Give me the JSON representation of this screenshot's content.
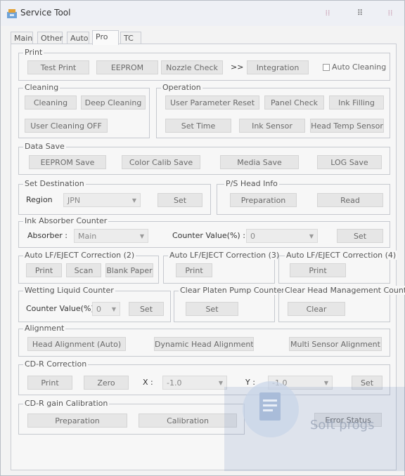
{
  "window": {
    "title": "Service Tool"
  },
  "tabs": [
    "Main",
    "Other",
    "Auto",
    "Pro",
    "TC"
  ],
  "print": {
    "label": "Print",
    "test_print": "Test Print",
    "eeprom": "EEPROM",
    "nozzle_check": "Nozzle Check",
    "arrows": ">>",
    "integration": "Integration",
    "auto_cleaning": "Auto Cleaning"
  },
  "cleaning": {
    "label": "Cleaning",
    "cleaning": "Cleaning",
    "deep_cleaning": "Deep Cleaning",
    "user_cleaning_off": "User Cleaning OFF"
  },
  "operation": {
    "label": "Operation",
    "user_param_reset": "User Parameter Reset",
    "panel_check": "Panel Check",
    "ink_filling": "Ink Filling",
    "set_time": "Set Time",
    "ink_sensor": "Ink Sensor",
    "head_temp_sensor": "Head Temp Sensor"
  },
  "data_save": {
    "label": "Data Save",
    "eeprom_save": "EEPROM Save",
    "color_calib_save": "Color Calib Save",
    "media_save": "Media Save",
    "log_save": "LOG Save"
  },
  "set_destination": {
    "label": "Set Destination",
    "region_label": "Region",
    "region_value": "JPN",
    "set": "Set"
  },
  "ps_head_info": {
    "label": "P/S Head Info",
    "preparation": "Preparation",
    "read": "Read"
  },
  "ink_absorber": {
    "label": "Ink Absorber Counter",
    "absorber_label": "Absorber :",
    "absorber_value": "Main",
    "counter_label": "Counter Value(%) :",
    "counter_value": "0",
    "set": "Set"
  },
  "auto_lf_2": {
    "label": "Auto LF/EJECT Correction (2)",
    "print": "Print",
    "scan": "Scan",
    "blank_paper": "Blank Paper"
  },
  "auto_lf_3": {
    "label": "Auto LF/EJECT Correction (3)",
    "print": "Print"
  },
  "auto_lf_4": {
    "label": "Auto LF/EJECT Correction (4)",
    "print": "Print"
  },
  "wetting": {
    "label": "Wetting Liquid Counter",
    "counter_label": "Counter Value(%)",
    "counter_value": "0",
    "set": "Set"
  },
  "platen": {
    "label": "Clear Platen Pump Counter",
    "set": "Set"
  },
  "head_mgmt": {
    "label": "Clear Head Management Count",
    "clear": "Clear"
  },
  "alignment": {
    "label": "Alignment",
    "head_alignment": "Head Alignment (Auto)",
    "dynamic_head_alignment": "Dynamic Head Alignment",
    "multi_sensor_alignment": "Multi Sensor Alignment"
  },
  "cdr_correction": {
    "label": "CD-R Correction",
    "print": "Print",
    "zero": "Zero",
    "x_label": "X :",
    "x_value": "-1.0",
    "y_label": "Y :",
    "y_value": "-1.0",
    "set": "Set"
  },
  "cdr_gain": {
    "label": "CD-R gain Calibration",
    "preparation": "Preparation",
    "calibration": "Calibration",
    "error_status": "Error Status"
  },
  "watermark": {
    "text": "Soft progs"
  }
}
